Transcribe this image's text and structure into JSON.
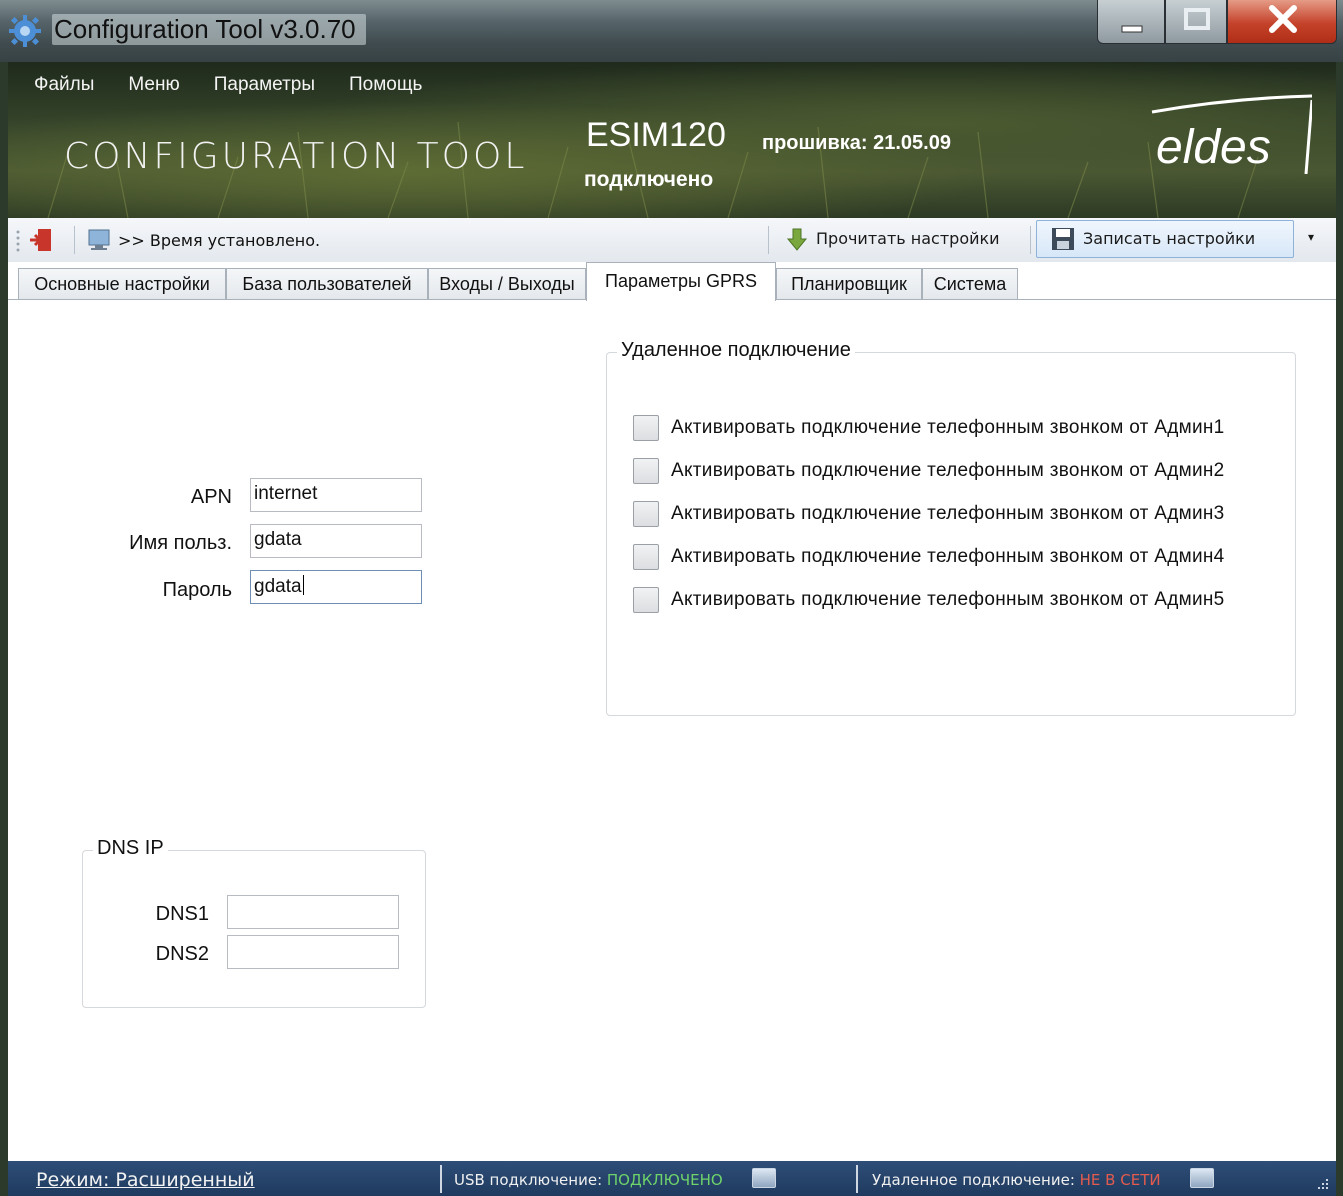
{
  "window": {
    "title": "Configuration Tool v3.0.70",
    "controls": {
      "minimize": "—",
      "maximize": "□",
      "close": "X"
    }
  },
  "menu": [
    "Файлы",
    "Меню",
    "Параметры",
    "Помощь"
  ],
  "banner": {
    "title": "CONFIGURATION TOOL",
    "device": "ESIM120",
    "firmware": "прошивка: 21.05.09",
    "status": "подключено",
    "logo": "eldes"
  },
  "toolbar": {
    "status_message": ">> Время установлено.",
    "read_label": "Прочитать настройки",
    "write_label": "Записать настройки",
    "dropdown": "▾",
    "icons": [
      "exit-icon",
      "computer-icon",
      "download-arrow-icon",
      "floppy-save-icon"
    ]
  },
  "tabs": [
    {
      "label": "Основные настройки",
      "active": false
    },
    {
      "label": "База пользователей",
      "active": false
    },
    {
      "label": "Входы / Выходы",
      "active": false
    },
    {
      "label": "Параметры GPRS",
      "active": true
    },
    {
      "label": "Планировщик",
      "active": false
    },
    {
      "label": "Система",
      "active": false
    }
  ],
  "gprs": {
    "apn": {
      "label": "APN",
      "value": "internet"
    },
    "username": {
      "label": "Имя польз.",
      "value": "gdata"
    },
    "password": {
      "label": "Пароль",
      "value": "gdata"
    }
  },
  "dns": {
    "title": "DNS IP",
    "dns1": {
      "label": "DNS1",
      "value": ""
    },
    "dns2": {
      "label": "DNS2",
      "value": ""
    }
  },
  "remote": {
    "title": "Удаленное подключение",
    "options": [
      {
        "label": "Активировать подключение телефонным звонком от Админ1",
        "checked": false
      },
      {
        "label": "Активировать подключение телефонным звонком от Админ2",
        "checked": false
      },
      {
        "label": "Активировать подключение телефонным звонком от Админ3",
        "checked": false
      },
      {
        "label": "Активировать подключение телефонным звонком от Админ4",
        "checked": false
      },
      {
        "label": "Активировать подключение телефонным звонком от Админ5",
        "checked": false
      }
    ]
  },
  "statusbar": {
    "mode": "Режим: Расширенный",
    "usb_label": "USB подключение:",
    "usb_value": "ПОДКЛЮЧЕНО",
    "remote_label": "Удаленное подключение:",
    "remote_value": "НЕ В СЕТИ"
  },
  "colors": {
    "status_ok": "#6ed36a",
    "status_bad": "#e35b4e",
    "statusbar_bg": "#1f3a5e"
  }
}
